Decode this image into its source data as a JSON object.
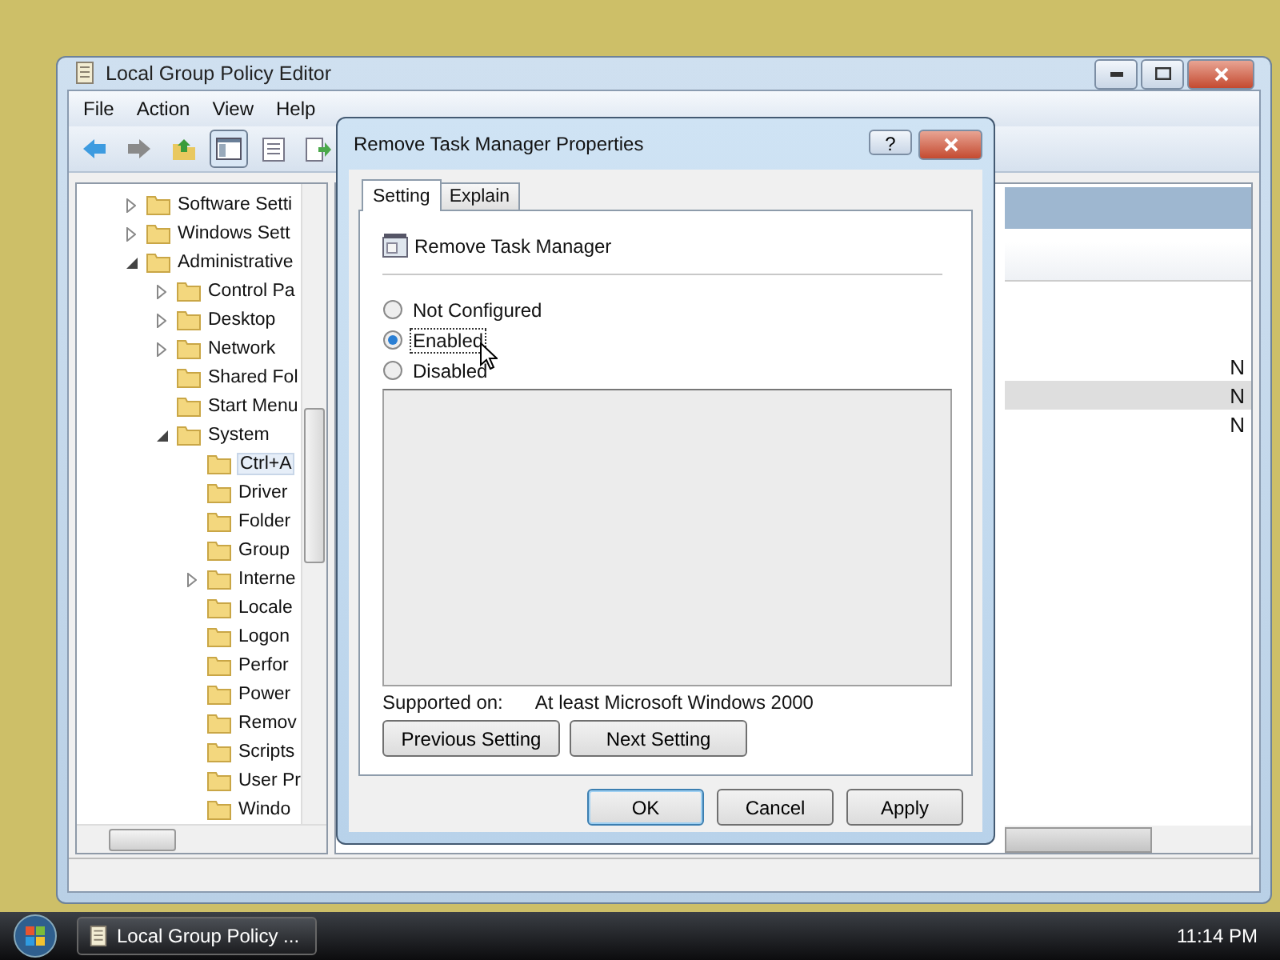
{
  "main_window": {
    "title": "Local Group Policy Editor",
    "menu": [
      "File",
      "Action",
      "View",
      "Help"
    ],
    "toolbar": [
      {
        "kind": "back",
        "pressed": false
      },
      {
        "kind": "forward",
        "pressed": false
      },
      {
        "kind": "up",
        "pressed": false
      },
      {
        "kind": "tree",
        "pressed": true
      },
      {
        "kind": "properties",
        "pressed": false
      },
      {
        "kind": "export",
        "pressed": false
      }
    ],
    "tree": [
      {
        "label": "Software Setti",
        "expanded": false,
        "selected": false
      },
      {
        "label": "Windows Sett",
        "expanded": false,
        "selected": false
      },
      {
        "label": "Administrative",
        "expanded": true,
        "selected": false,
        "children": [
          {
            "label": "Control Pa",
            "expanded": false,
            "selected": false
          },
          {
            "label": "Desktop",
            "expanded": false,
            "selected": false
          },
          {
            "label": "Network",
            "expanded": false,
            "selected": false
          },
          {
            "label": "Shared Fol",
            "selected": false
          },
          {
            "label": "Start Menu",
            "selected": false
          },
          {
            "label": "System",
            "expanded": true,
            "selected": false,
            "children": [
              {
                "label": "Ctrl+A",
                "selected": true
              },
              {
                "label": "Driver",
                "selected": false
              },
              {
                "label": "Folder",
                "selected": false
              },
              {
                "label": "Group",
                "selected": false
              },
              {
                "label": "Interne",
                "expanded": false,
                "selected": false
              },
              {
                "label": "Locale",
                "selected": false
              },
              {
                "label": "Logon",
                "selected": false
              },
              {
                "label": "Perfor",
                "selected": false
              },
              {
                "label": "Power",
                "selected": false
              },
              {
                "label": "Remov",
                "selected": false
              },
              {
                "label": "Scripts",
                "selected": false
              },
              {
                "label": "User Pr",
                "selected": false
              },
              {
                "label": "Windo",
                "selected": false
              }
            ]
          }
        ]
      }
    ],
    "list_rows": [
      {
        "column_2": "N",
        "highlighted": false
      },
      {
        "column_2": "N",
        "highlighted": true
      },
      {
        "column_2": "N",
        "highlighted": false
      }
    ]
  },
  "dialog": {
    "title": "Remove Task Manager Properties",
    "help_button": "?",
    "tabs": [
      {
        "label": "Setting",
        "selected": true
      },
      {
        "label": "Explain",
        "selected": false
      }
    ],
    "policy_name": "Remove Task Manager",
    "options": [
      {
        "label": "Not Configured",
        "selected": false,
        "focused": false
      },
      {
        "label": "Enabled",
        "selected": true,
        "focused": true
      },
      {
        "label": "Disabled",
        "selected": false,
        "focused": false
      }
    ],
    "supported_label": "Supported on:",
    "supported_value": "At least Microsoft Windows 2000",
    "nav_buttons": [
      "Previous Setting",
      "Next Setting"
    ],
    "buttons": [
      {
        "label": "OK",
        "default": true
      },
      {
        "label": "Cancel",
        "default": false
      },
      {
        "label": "Apply",
        "default": false
      }
    ]
  },
  "taskbar": {
    "task": "Local Group Policy ...",
    "clock": "11:14 PM"
  }
}
